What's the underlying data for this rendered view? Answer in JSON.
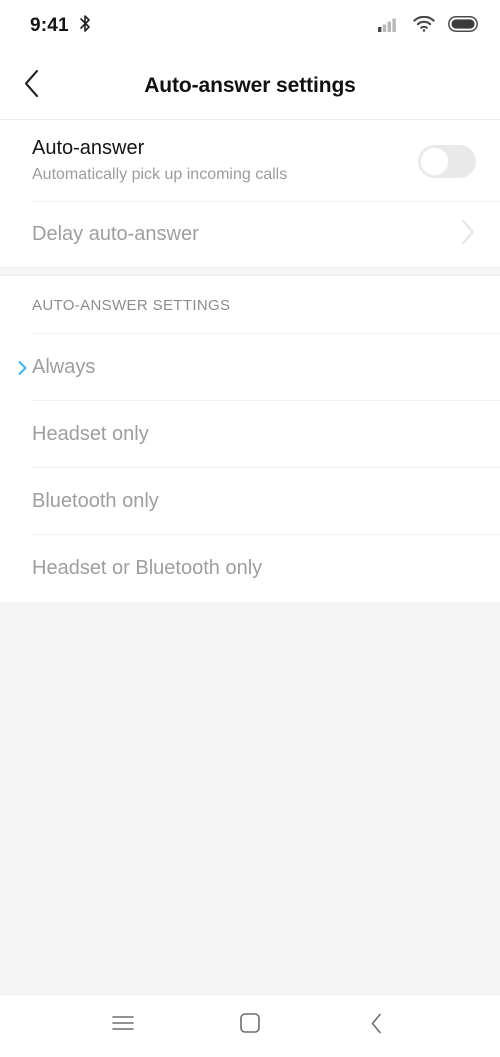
{
  "status_bar": {
    "clock": "9:41",
    "bluetooth_icon": "bluetooth-icon",
    "signal_icon": "cellular-signal-icon",
    "wifi_icon": "wifi-icon",
    "battery_icon": "battery-full-icon"
  },
  "header": {
    "title": "Auto-answer settings",
    "back_icon": "back-chevron-icon"
  },
  "settings": {
    "auto_answer": {
      "title": "Auto-answer",
      "subtitle": "Automatically pick up incoming calls",
      "toggle_state": "off"
    },
    "delay": {
      "title": "Delay auto-answer",
      "enabled": "false",
      "chevron_icon": "chevron-right-icon"
    }
  },
  "section": {
    "header": "AUTO-ANSWER SETTINGS",
    "options": [
      {
        "label": "Always",
        "selected": "true",
        "marker_icon": "chevron-right-marker-icon"
      },
      {
        "label": "Headset only",
        "selected": "false",
        "marker_icon": ""
      },
      {
        "label": "Bluetooth only",
        "selected": "false",
        "marker_icon": ""
      },
      {
        "label": "Headset or Bluetooth only",
        "selected": "false",
        "marker_icon": ""
      }
    ]
  },
  "nav_bar": {
    "recents_icon": "menu-icon",
    "home_icon": "home-square-icon",
    "back_icon": "back-chevron-icon"
  },
  "colors": {
    "accent": "#4cb6e8",
    "primary_text": "#151515",
    "muted_text": "#9e9e9e",
    "background": "#f5f5f5",
    "surface": "#ffffff"
  }
}
